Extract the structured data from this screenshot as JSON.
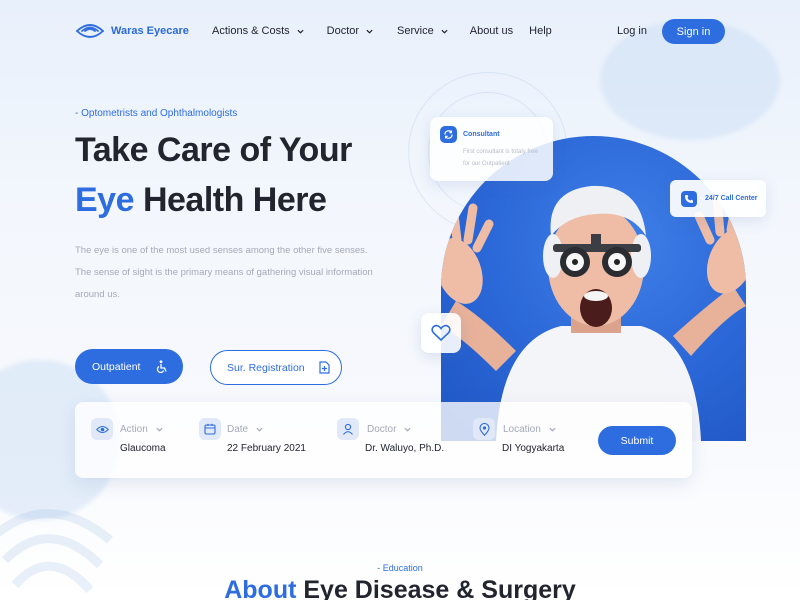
{
  "brand": {
    "name": "Waras Eyecare",
    "accent": "#2e6de0"
  },
  "nav": {
    "items": [
      {
        "label": "Actions & Costs",
        "dropdown": true
      },
      {
        "label": "Doctor",
        "dropdown": true
      },
      {
        "label": "Service",
        "dropdown": true
      },
      {
        "label": "About us",
        "dropdown": false
      },
      {
        "label": "Help",
        "dropdown": false
      }
    ],
    "login": "Log in",
    "signin": "Sign in"
  },
  "hero": {
    "kicker": "- Optometrists and Ophthalmologists",
    "title_line1": "Take Care of Your",
    "title_line2_accent": "Eye",
    "title_line2_rest": " Health Here",
    "description": "The eye is one of the most used senses among the other five senses. The sense of sight is the primary means of gathering visual information around us.",
    "btn_outpatient": "Outpatient",
    "btn_registration": "Sur. Registration"
  },
  "cards": {
    "consultant_title": "Consultant",
    "consultant_text": "First consultant is totaly free for our Outpatient",
    "call_center": "24/7 Call Center"
  },
  "booking": {
    "fields": [
      {
        "icon": "eye-icon",
        "label": "Action",
        "value": "Glaucoma"
      },
      {
        "icon": "calendar-icon",
        "label": "Date",
        "value": "22 February 2021"
      },
      {
        "icon": "user-icon",
        "label": "Doctor",
        "value": "Dr. Waluyo, Ph.D."
      },
      {
        "icon": "location-icon",
        "label": "Location",
        "value": "DI Yogyakarta"
      }
    ],
    "submit": "Submit"
  },
  "education": {
    "kicker": "- Education",
    "title_accent": "About",
    "title_rest": " Eye Disease & Surgery"
  }
}
